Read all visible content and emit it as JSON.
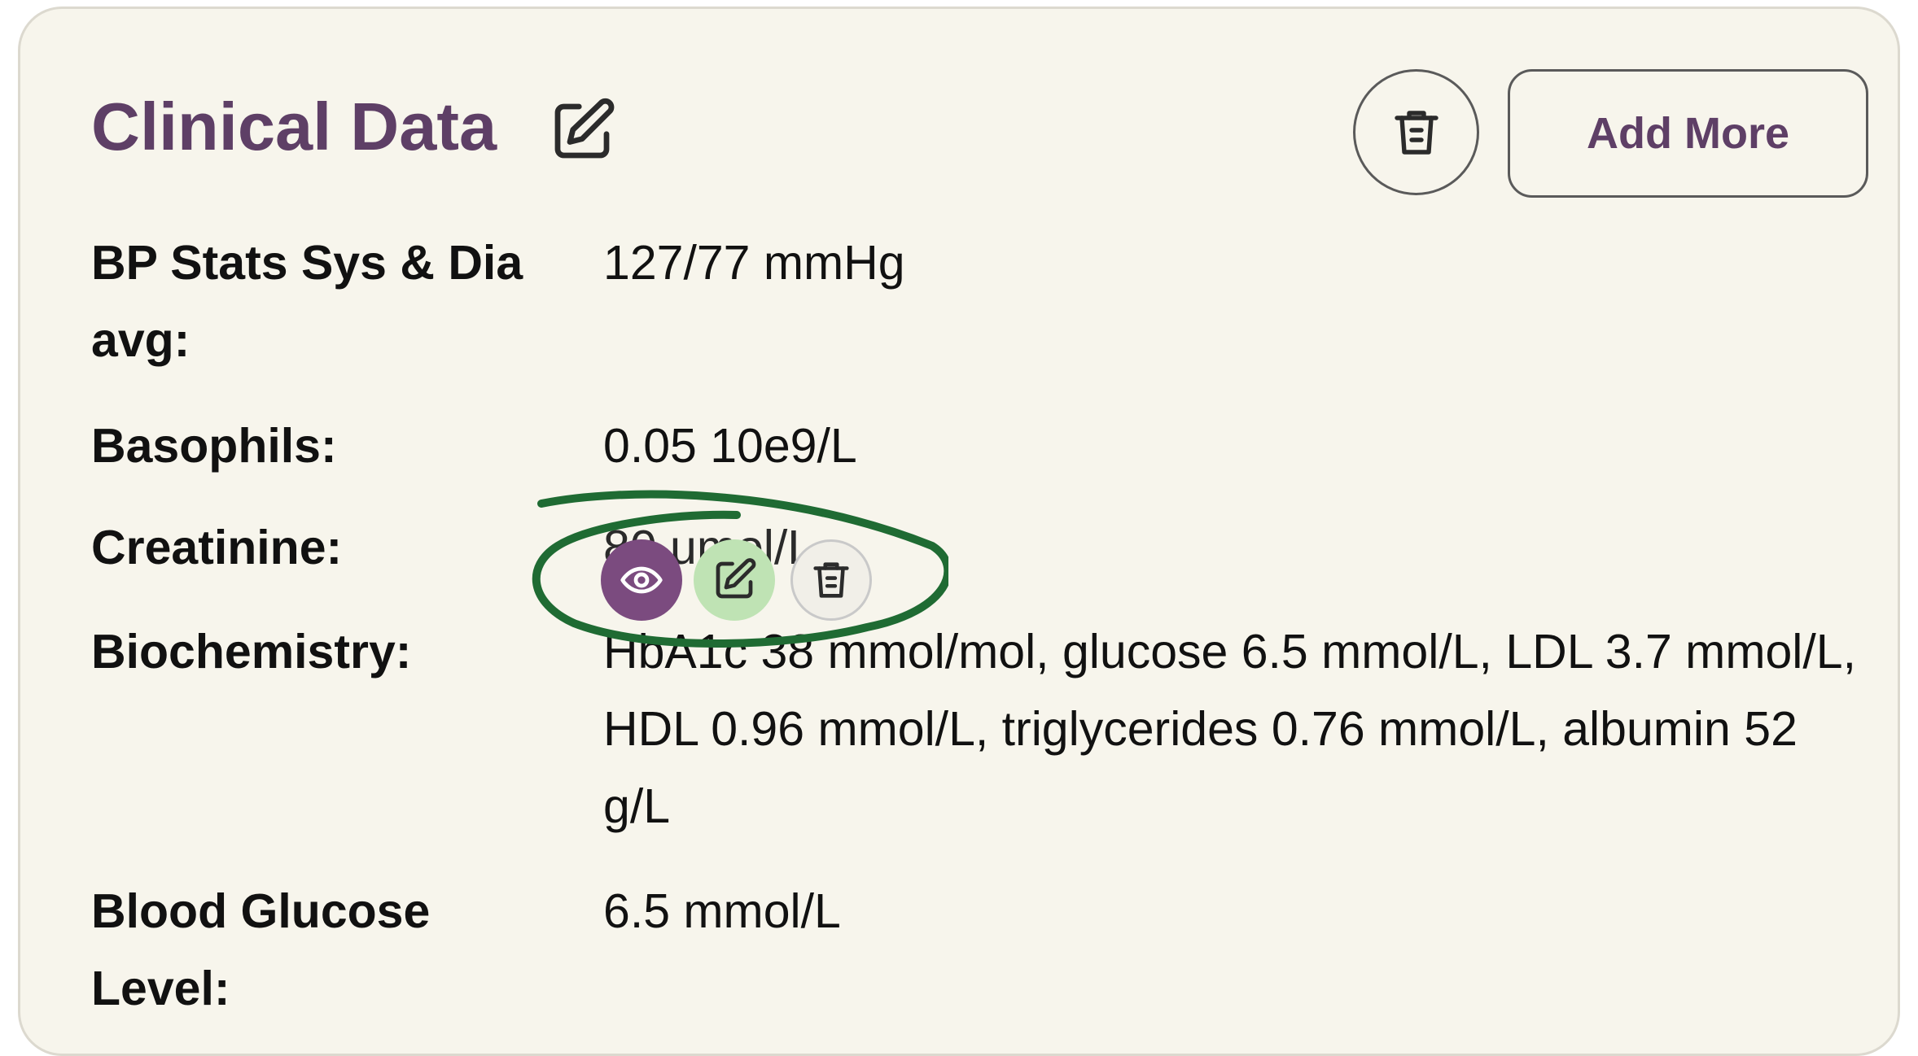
{
  "card": {
    "title": "Clinical Data",
    "add_more_label": "Add More"
  },
  "rows": [
    {
      "label": "BP Stats Sys & Dia avg:",
      "value": "127/77 mmHg"
    },
    {
      "label": "Basophils:",
      "value": "0.05 10e9/L"
    },
    {
      "label": "Creatinine:",
      "value": "80 umol/L"
    },
    {
      "label": "Biochemistry:",
      "value": "HbA1c 38 mmol/mol, glucose 6.5 mmol/L, LDL 3.7 mmol/L, HDL 0.96 mmol/L, triglycerides 0.76 mmol/L, albumin 52 g/L"
    },
    {
      "label": "Blood Glucose Level:",
      "value": "6.5 mmol/L"
    }
  ],
  "icons": {
    "title_edit": "edit-icon",
    "header_delete": "trash-icon",
    "row_view": "eye-icon",
    "row_edit": "edit-icon",
    "row_delete": "trash-icon"
  },
  "colors": {
    "card_background": "#f7f5ec",
    "title": "#5e3f66",
    "view_button": "#7b4b7f",
    "edit_button": "#bfe3b4",
    "highlight_ring": "#1f6b33"
  }
}
